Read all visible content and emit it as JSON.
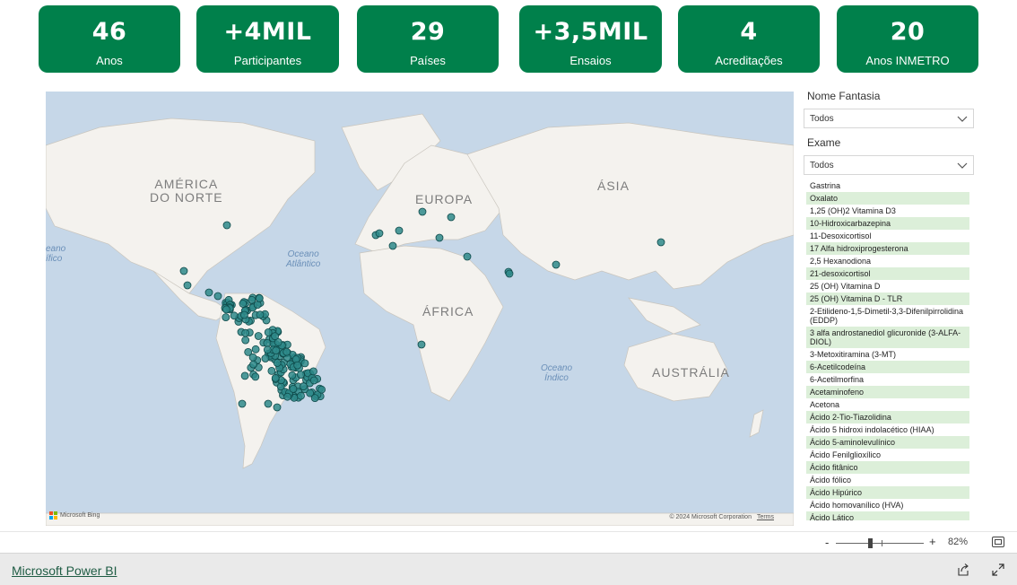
{
  "kpis": [
    {
      "value": "46",
      "label": "Anos"
    },
    {
      "value": "+4MIL",
      "label": "Participantes"
    },
    {
      "value": "29",
      "label": "Países"
    },
    {
      "value": "+3,5MIL",
      "label": "Ensaios"
    },
    {
      "value": "4",
      "label": "Acreditações"
    },
    {
      "value": "20",
      "label": "Anos INMETRO"
    }
  ],
  "map": {
    "labels": {
      "north_america": "AMÉRICA\nDO NORTE",
      "europe": "EUROPA",
      "asia": "ÁSIA",
      "africa": "ÁFRICA",
      "australia": "AUSTRÁLIA",
      "atlantic": "Oceano\nAtlântico",
      "indian": "Oceano\nÍndico",
      "pacific": "eano\nífico"
    },
    "attribution": "© 2024 Microsoft Corporation",
    "terms": "Terms",
    "bing": "Microsoft Bing",
    "colors": {
      "water": "#c6d7e8",
      "land": "#f4f2ee",
      "dot": "#2e8a8a",
      "dot_stroke": "#0f4a4a"
    }
  },
  "filters": {
    "nome_fantasia": {
      "title": "Nome Fantasia",
      "value": "Todos"
    },
    "exame": {
      "title": "Exame",
      "value": "Todos"
    }
  },
  "exam_list": [
    "Gastrina",
    "Oxalato",
    "1,25 (OH)2 Vitamina D3",
    "10-Hidroxicarbazepina",
    "11-Desoxicortisol",
    "17 Alfa hidroxiprogesterona",
    "2,5 Hexanodiona",
    "21-desoxicortisol",
    "25 (OH) Vitamina D",
    "25 (OH) Vitamina D - TLR",
    "2-Etilideno-1,5-Dimetil-3,3-Difenilpirrolidina (EDDP)",
    "3 alfa androstanediol glicuronide (3-ALFA-DIOL)",
    "3-Metoxitiramina (3-MT)",
    "6-Acetilcodeína",
    "6-Acetilmorfina",
    "Acetaminofeno",
    "Acetona",
    "Ácido 2-Tio-Tiazolidina",
    "Ácido 5 hidroxi indolacético (HIAA)",
    "Ácido 5-aminolevulínico",
    "Ácido Fenilglioxílico",
    "Ácido fitânico",
    "Ácido fólico",
    "Ácido Hipúrico",
    "Ácido homovanílico (HVA)",
    "Ácido Lático"
  ],
  "zoom": {
    "minus": "-",
    "plus": "+",
    "percent": "82%"
  },
  "footer": {
    "brand": "Microsoft Power BI"
  },
  "theme": {
    "kpi_bg": "#00804b",
    "list_alt": "#dcefd9"
  }
}
